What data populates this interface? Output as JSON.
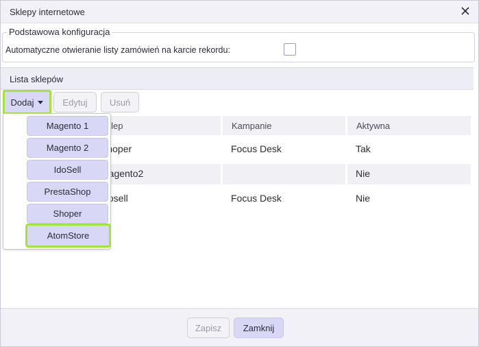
{
  "dialog": {
    "title": "Sklepy internetowe"
  },
  "config": {
    "legend": "Podstawowa konfiguracja",
    "auto_open_label": "Automatyczne otwieranie listy zamówień na karcie rekordu:",
    "auto_open_checked": false
  },
  "shops": {
    "section_title": "Lista sklepów",
    "toolbar": {
      "add_label": "Dodaj",
      "edit_label": "Edytuj",
      "delete_label": "Usuń"
    },
    "columns": [
      "Sklep",
      "Kampanie",
      "Aktywna"
    ],
    "rows": [
      {
        "sklep": "Shoper",
        "kampanie": "Focus Desk",
        "aktywna": "Tak"
      },
      {
        "sklep": "magento2",
        "kampanie": "",
        "aktywna": "Nie"
      },
      {
        "sklep": "idosell",
        "kampanie": "Focus Desk",
        "aktywna": "Nie"
      }
    ],
    "add_menu": [
      "Magento 1",
      "Magento 2",
      "IdoSell",
      "PrestaShop",
      "Shoper",
      "AtomStore"
    ]
  },
  "footer": {
    "save_label": "Zapisz",
    "close_label": "Zamknij"
  },
  "colors": {
    "accent": "#d8d8f6",
    "highlight": "#a3e43a",
    "header_bg": "#f1f1f7"
  }
}
